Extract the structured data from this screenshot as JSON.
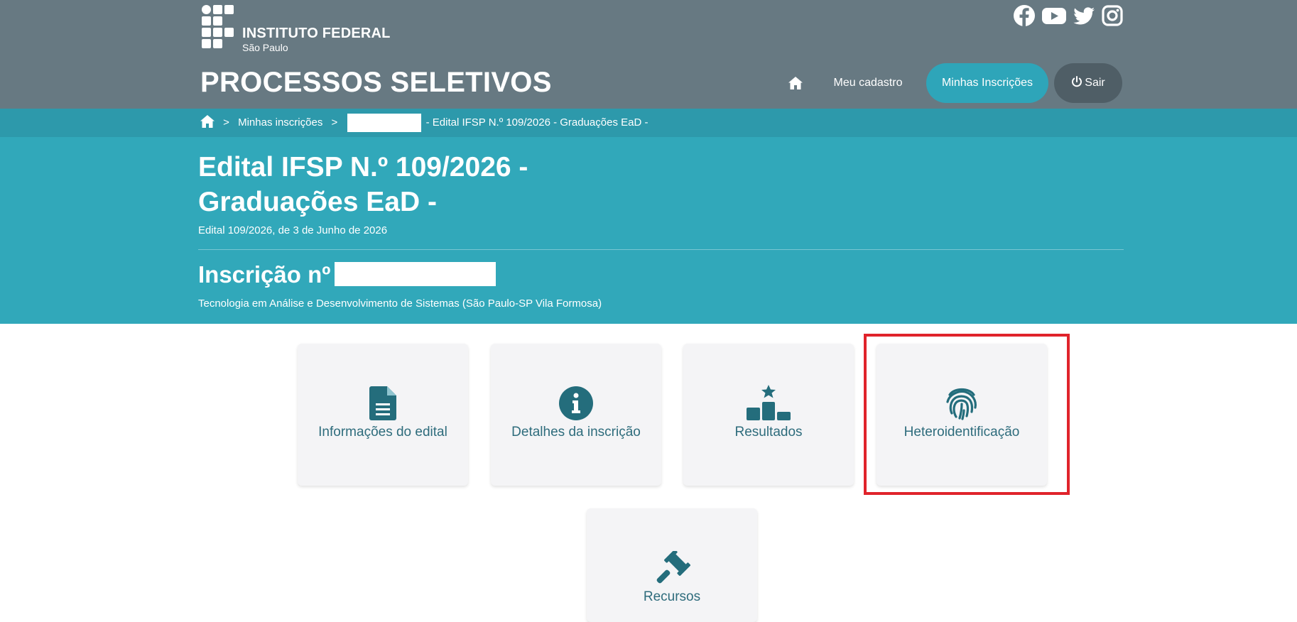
{
  "header": {
    "logo": {
      "name": "INSTITUTO FEDERAL",
      "sub": "São Paulo"
    },
    "site_title": "PROCESSOS SELETIVOS",
    "social": [
      "facebook-icon",
      "youtube-icon",
      "twitter-icon",
      "instagram-icon"
    ],
    "nav": {
      "home_icon": "home-icon",
      "meu_cadastro": "Meu cadastro",
      "minhas_inscricoes": "Minhas Inscrições",
      "sair": "Sair"
    }
  },
  "breadcrumb": {
    "home_icon": "home-icon",
    "sep": ">",
    "item1": "Minhas inscrições",
    "item3": "- Edital IFSP N.º 109/2026 - Graduações EaD -"
  },
  "hero": {
    "title_line1": "Edital IFSP N.º 109/2026 -",
    "title_line2": "Graduações EaD -",
    "subtitle": "Edital 109/2026, de 3 de Junho de 2026",
    "inscricao_label": "Inscrição nº",
    "course": "Tecnologia em Análise e Desenvolvimento de Sistemas (São Paulo-SP Vila Formosa)"
  },
  "cards": [
    {
      "label": "Informações do edital",
      "icon": "document-icon"
    },
    {
      "label": "Detalhes da inscrição",
      "icon": "info-icon"
    },
    {
      "label": "Resultados",
      "icon": "podium-icon"
    },
    {
      "label": "Heteroidentificação",
      "icon": "fingerprint-icon"
    },
    {
      "label": "Recursos",
      "icon": "gavel-icon"
    }
  ],
  "colors": {
    "header_bg": "#677982",
    "breadcrumb_bg": "#2d99ab",
    "hero_bg": "#31a8ba",
    "accent": "#2ea5b9",
    "icon": "#246d7c",
    "highlight": "#e0232b"
  }
}
